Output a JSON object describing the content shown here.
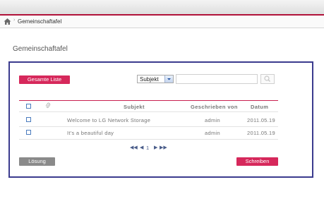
{
  "breadcrumb": {
    "home_icon": "home-icon",
    "separator": "›",
    "current": "Gemeinschaftafel"
  },
  "page": {
    "title": "Gemeinschaftafel"
  },
  "toolbar": {
    "all_list_label": "Gesamte Liste",
    "search_field_selected": "Subjekt",
    "search_placeholder": "",
    "search_icon": "search-icon"
  },
  "table": {
    "columns": [
      "Subjekt",
      "Geschrieben von",
      "Datum"
    ],
    "attachment_icon": "paperclip-icon",
    "rows": [
      {
        "subject": "Welcome to LG Network Storage",
        "author": "admin",
        "date": "2011.05.19"
      },
      {
        "subject": "It's a beautiful day",
        "author": "admin",
        "date": "2011.05.19"
      }
    ]
  },
  "pagination": {
    "first": "◀◀",
    "prev": "◀",
    "current": "1",
    "next": "▶",
    "last": "▶▶"
  },
  "actions": {
    "delete_label": "Lösung",
    "write_label": "Schreiben"
  },
  "colors": {
    "accent": "#d6285b",
    "frame": "#3b3b8e",
    "checkbox": "#4a7bbd"
  }
}
